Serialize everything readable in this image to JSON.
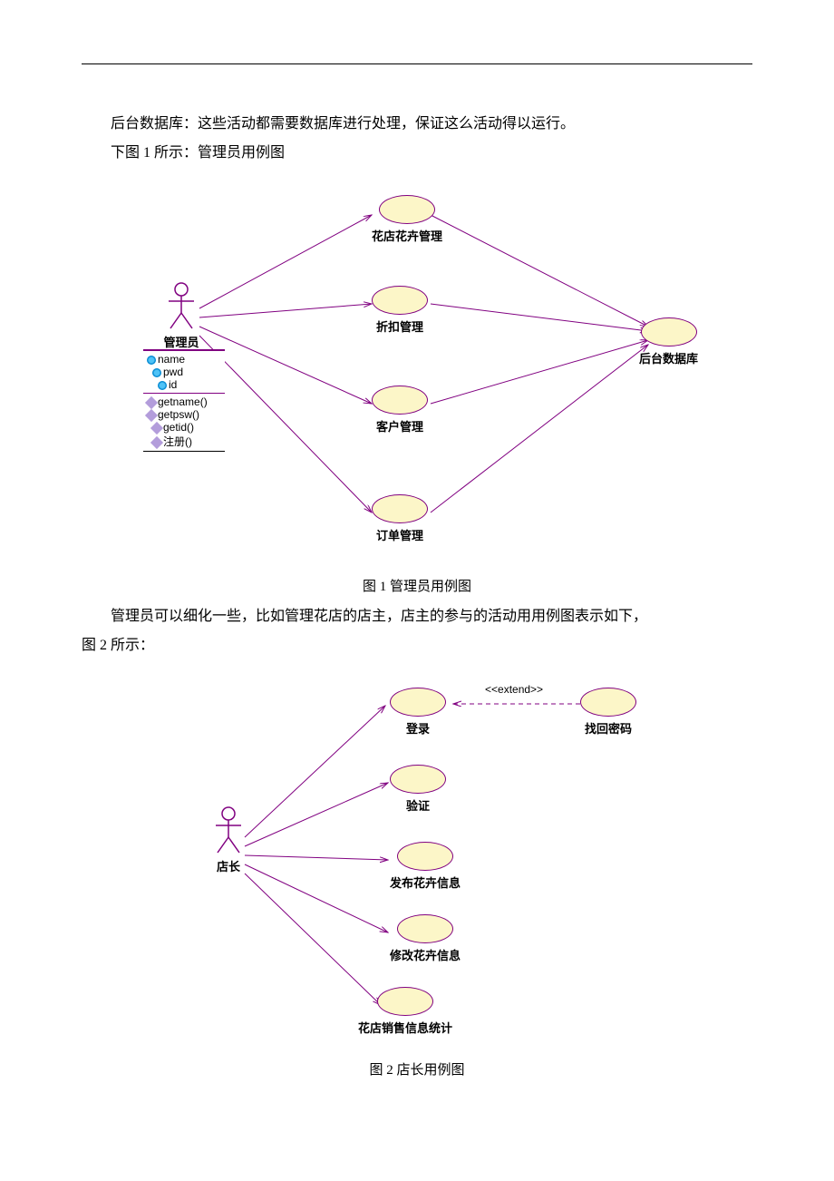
{
  "text": {
    "para1": "后台数据库：这些活动都需要数据库进行处理，保证这么活动得以运行。",
    "para2": "下图 1 所示：管理员用例图",
    "caption1": "图 1  管理员用例图",
    "para3_line1": "管理员可以细化一些，比如管理花店的店主，店主的参与的活动用用例图表示如下，",
    "para3_line2": "图 2 所示：",
    "caption2": "图 2  店长用例图"
  },
  "diagram1": {
    "actor": {
      "label": "管理员"
    },
    "attributes": [
      "name",
      "pwd",
      "id"
    ],
    "operations": [
      "getname()",
      "getpsw()",
      "getid()",
      "注册()"
    ],
    "usecases": {
      "uc1": "花店花卉管理",
      "uc2": "折扣管理",
      "uc3": "客户管理",
      "uc4": "订单管理",
      "right": "后台数据库"
    }
  },
  "diagram2": {
    "actor": {
      "label": "店长"
    },
    "extend": "<<extend>>",
    "usecases": {
      "uc1": "登录",
      "uc2": "验证",
      "uc3": "发布花卉信息",
      "uc4": "修改花卉信息",
      "uc5": "花店销售信息统计",
      "right": "找回密码"
    }
  }
}
